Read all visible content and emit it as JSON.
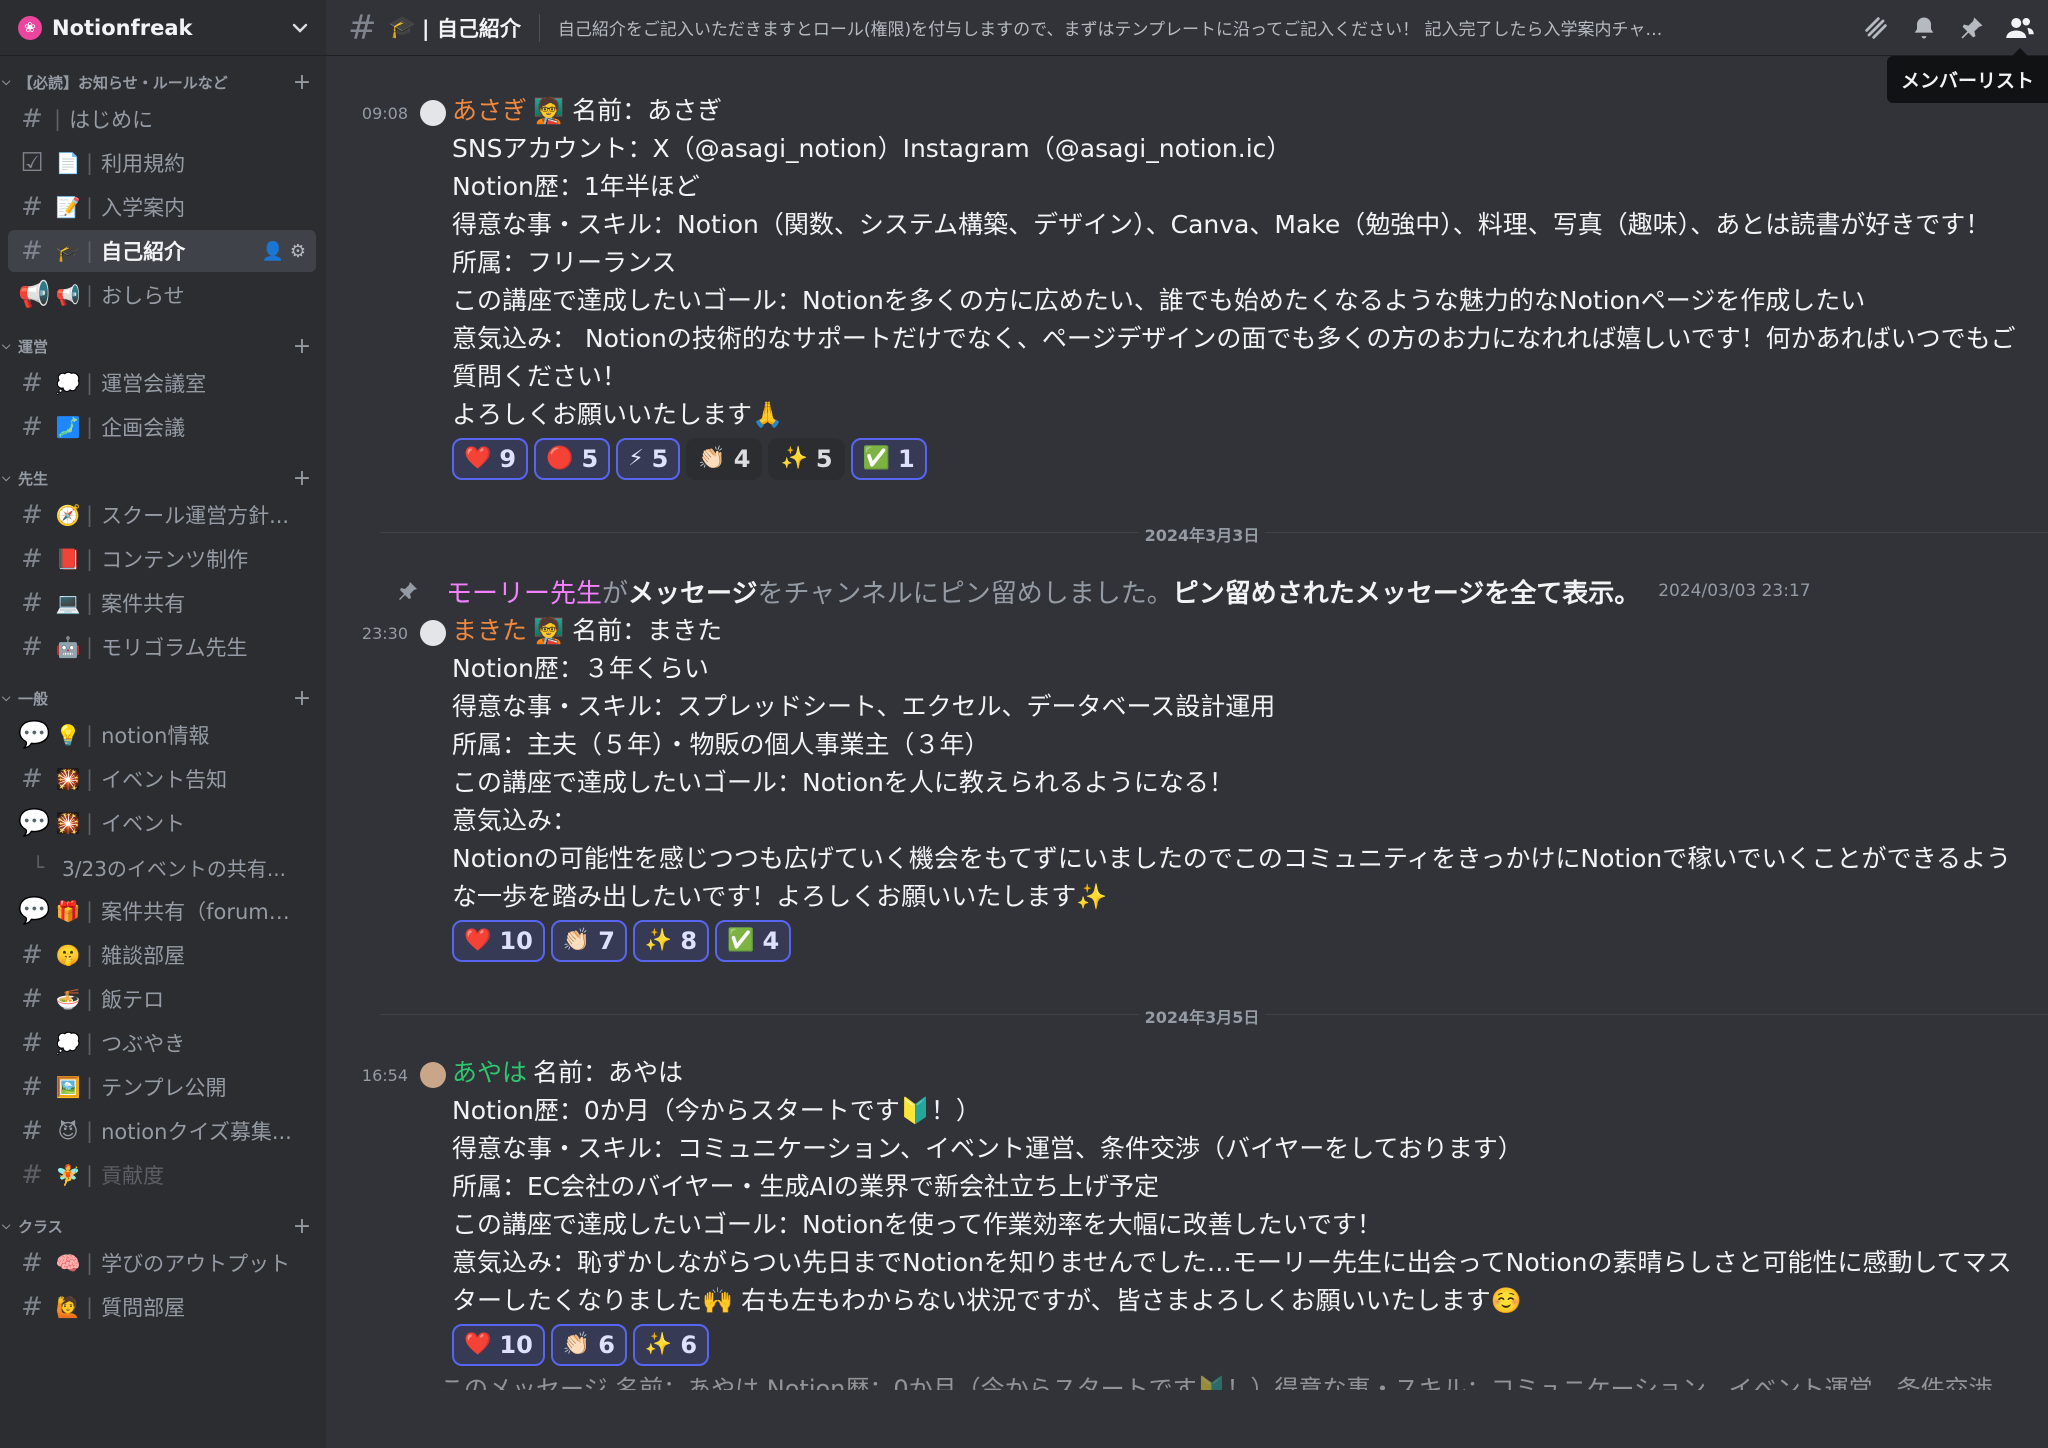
{
  "server": {
    "name": "Notionfreak",
    "icon": "❀"
  },
  "sidebar": {
    "categories": [
      {
        "label": "【必読】お知らせ・ルールなど",
        "channels": [
          {
            "type": "hash",
            "emoji": "",
            "name": "はじめに"
          },
          {
            "type": "rules",
            "emoji": "📄",
            "name": "利用規約"
          },
          {
            "type": "hash",
            "emoji": "📝",
            "name": "入学案内"
          },
          {
            "type": "hash",
            "emoji": "🎓",
            "name": "自己紹介",
            "active": true
          },
          {
            "type": "announce",
            "emoji": "📢",
            "name": "おしらせ"
          }
        ]
      },
      {
        "label": "運営",
        "channels": [
          {
            "type": "hash",
            "emoji": "💭",
            "name": "運営会議室"
          },
          {
            "type": "hash",
            "emoji": "🗾",
            "name": "企画会議"
          }
        ]
      },
      {
        "label": "先生",
        "channels": [
          {
            "type": "hash",
            "emoji": "🧭",
            "name": "スクール運営方針..."
          },
          {
            "type": "hash",
            "emoji": "📕",
            "name": "コンテンツ制作"
          },
          {
            "type": "hash",
            "emoji": "💻",
            "name": "案件共有"
          },
          {
            "type": "hash",
            "emoji": "🤖",
            "name": "モリゴラム先生"
          }
        ]
      },
      {
        "label": "一般",
        "channels": [
          {
            "type": "forum",
            "emoji": "💡",
            "name": "notion情報"
          },
          {
            "type": "hash",
            "emoji": "🎇",
            "name": "イベント告知"
          },
          {
            "type": "forum2",
            "emoji": "🎇",
            "name": "イベント"
          },
          {
            "type": "thread",
            "emoji": "",
            "name": "3/23のイベントの共有..."
          },
          {
            "type": "forum",
            "emoji": "🎁",
            "name": "案件共有（forum機..."
          },
          {
            "type": "hash",
            "emoji": "🤫",
            "name": "雑談部屋"
          },
          {
            "type": "hash",
            "emoji": "🍜",
            "name": "飯テロ"
          },
          {
            "type": "hash",
            "emoji": "💭",
            "name": "つぶやき"
          },
          {
            "type": "hash",
            "emoji": "🖼️",
            "name": "テンプレ公開"
          },
          {
            "type": "hash",
            "emoji": "😈",
            "name": "notionクイズ募集..."
          },
          {
            "type": "hash",
            "emoji": "🧚",
            "name": "貢献度",
            "muted": true
          }
        ]
      },
      {
        "label": "クラス",
        "channels": [
          {
            "type": "hash",
            "emoji": "🧠",
            "name": "学びのアウトプット"
          },
          {
            "type": "hash",
            "emoji": "🙋",
            "name": "質問部屋"
          }
        ]
      }
    ]
  },
  "channel": {
    "emoji": "🎓",
    "title": "自己紹介",
    "topic": "自己紹介をご記入いただきますとロール(権限)を付与しますので、まずはテンプレートに沿ってご記入ください！ 記入完了したら入学案内チャ…"
  },
  "header_icons": [
    "threads-icon",
    "bell-icon",
    "pin-icon",
    "members-icon"
  ],
  "tooltip": "メンバーリスト",
  "messages": [
    {
      "time": "09:08",
      "author": "あさぎ",
      "author_color": "#f0883e",
      "badge": "🧑‍🏫",
      "lines": [
        "名前：あさぎ",
        "SNSアカウント：X（@asagi_notion）Instagram（@asagi_notion.ic）",
        "Notion歴：1年半ほど",
        "得意な事・スキル：Notion（関数、システム構築、デザイン）、Canva、Make（勉強中）、料理、写真（趣味）、あとは読書が好きです！",
        "所属：フリーランス",
        "この講座で達成したいゴール：Notionを多くの方に広めたい、誰でも始めたくなるような魅力的なNotionページを作成したい",
        "意気込み： Notionの技術的なサポートだけでなく、ページデザインの面でも多くの方のお力になれれば嬉しいです！何かあればいつでもご質問ください！",
        "よろしくお願いいたします🙏"
      ],
      "reactions": [
        {
          "emoji": "❤️",
          "count": "9",
          "me": true
        },
        {
          "emoji": "🔴",
          "count": "5",
          "me": true
        },
        {
          "emoji": "⚡",
          "count": "5",
          "me": true
        },
        {
          "emoji": "👏🏻",
          "count": "4",
          "me": false
        },
        {
          "emoji": "✨",
          "count": "5",
          "me": false
        },
        {
          "emoji": "✅",
          "count": "1",
          "me": true
        }
      ]
    },
    {
      "date": "2024年3月3日",
      "system": {
        "who": "モーリー先生",
        "t1": " が",
        "t2": "メッセージ",
        "t3": "をチャンネルにピン留めしました。",
        "t4": "ピン留めされたメッセージを全て表示。",
        "stamp": "2024/03/03 23:17"
      },
      "time": "23:30",
      "author": "まきた",
      "author_color": "#f0883e",
      "badge": "🧑‍🏫",
      "lines": [
        "名前：まきた",
        "Notion歴：３年くらい",
        "得意な事・スキル：スプレッドシート、エクセル、データベース設計運用",
        "所属：主夫（５年）・物販の個人事業主（３年）",
        "この講座で達成したいゴール：Notionを人に教えられるようになる！",
        "意気込み：",
        "Notionの可能性を感じつつも広げていく機会をもてずにいましたのでこのコミュニティをきっかけにNotionで稼いでいくことができるような一歩を踏み出したいです！よろしくお願いいたします✨"
      ],
      "reactions": [
        {
          "emoji": "❤️",
          "count": "10",
          "me": true
        },
        {
          "emoji": "👏🏻",
          "count": "7",
          "me": true
        },
        {
          "emoji": "✨",
          "count": "8",
          "me": true
        },
        {
          "emoji": "✅",
          "count": "4",
          "me": true
        }
      ]
    },
    {
      "date": "2024年3月5日",
      "time": "16:54",
      "author": "あやは",
      "author_color": "#2dc770",
      "badge": "",
      "lines": [
        "名前：あやは",
        "Notion歴：0か月（今からスタートです🔰！）",
        "得意な事・スキル：コミュニケーション、イベント運営、条件交渉（バイヤーをしております）",
        "所属：EC会社のバイヤー・生成AIの業界で新会社立ち上げ予定",
        "この講座で達成したいゴール：Notionを使って作業効率を大幅に改善したいです！",
        "意気込み：恥ずかしながらつい先日までNotionを知りませんでした…モーリー先生に出会ってNotionの素晴らしさと可能性に感動してマスターしたくなりました🙌 右も左もわからない状況ですが、皆さまよろしくお願いいたします☺️"
      ],
      "reactions": [
        {
          "emoji": "❤️",
          "count": "10",
          "me": true
        },
        {
          "emoji": "👏🏻",
          "count": "6",
          "me": true
        },
        {
          "emoji": "✨",
          "count": "6",
          "me": true
        }
      ]
    }
  ],
  "cutoff_text": "このメッセージ 名前：あやは Notion歴：0か月（今からスタートです🔰！）得意な事・スキル：コミュニケーション、イベント運営、条件交渉（バ"
}
